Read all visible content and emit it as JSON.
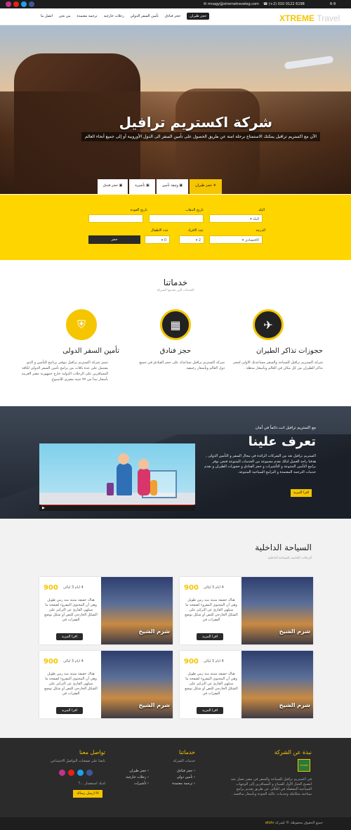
{
  "topbar": {
    "date": "6-9",
    "phone": "(+2) 010 0122 6198",
    "email": "mnagy@xtremetraveleg.com"
  },
  "nav": {
    "logo_a": "XTREME",
    "logo_b": "Travel",
    "items": [
      "حجز طيران",
      "حجز فنادق",
      "تأمين السفر الدولي",
      "رحلات خارجية",
      "ترجمة معتمدة",
      "من نحن",
      "اتصل بنا"
    ]
  },
  "hero": {
    "title": "شركة اكستريم ترافيل",
    "subtitle": "الآن مع اكستريم ترافيل يمكنك الاستمتاع برحلة امنة عن طريق الحصول على تأمين السفر الى الدول الأوروبية أو إلى جميع أنحاء العالم"
  },
  "tabs": [
    "حجز طيران",
    "وثيقة تأمين",
    "تأشيرة",
    "حجز فندق"
  ],
  "search": {
    "country_label": "البلد",
    "country_value": "البلد",
    "depart_label": "تاريخ الذهاب",
    "return_label": "تاريخ العودة",
    "class_label": "الدرجة",
    "class_value": "الاقتصادى",
    "adults_label": "عدد الافراد",
    "adults_value": "2",
    "kids_label": "عدد الاطفال",
    "kids_value": "0",
    "submit": "حجز"
  },
  "services": {
    "title": "خدماتنا",
    "sub": "الخدمات التي تقدمها الشركة",
    "items": [
      {
        "icon": "globe-icon",
        "title": "حجوزات تذاكر الطيران",
        "text": "شركة اكستريم ترافيل للسياحة والسفر مساعدتك الاولي لحجز تذاكر الطيران من كل مكان في العالم وبأسعار مذهلة ."
      },
      {
        "icon": "building-icon",
        "title": "حجز فنادق",
        "text": "شركة اكستريم ترافيل تساعدك على حجز الفنادق في جميع دول العالم وبأسعار رخيصة"
      },
      {
        "icon": "shield-icon",
        "title": "تأمين السفر الدولى",
        "text": "تتميز شركة اكستريم ترافيل بتوفير برنامج للتأمين و الذي يشتمل على عدة باقات من برامج تأمين السفر الدولي لكافة المسافرين على الرحلات الدولية خارج جمهورية مصر العربية بأسعار تبدأ من ٧٧ جنية مصرى للاسبوع."
      }
    ]
  },
  "about": {
    "kicker": "مع اكستريم ترافيل انت دائماً في أمان",
    "title": "تعرف علينا",
    "text": "اكستريم ترافيل تعد من الشركات الرائدة في مجال السفر و التأمين الدولى , هدفنا راحة العميل لذلك نقدم مجموعة من الخدمات المتنوعة فنحن نوفر برامج التأمين المتنوعة و التأشيرات و حجز الفنادق و حجوزات الطيران و نقدم خدمات الترجمة المعتمدة و البرامج السياحية المتنوعة.",
    "more": "اقرا المزيد"
  },
  "domestic": {
    "title": "السياحة الداخلية",
    "sub": "الرحلات الخاصة بالسياحة الداخلية",
    "cards": [
      {
        "price": "900",
        "duration": "4 ايام 3 ليالى",
        "dest": "شرم الشيخ",
        "desc": "هناك حقيقة مثبتة منذ زمن طويل وهي أن المحتوى المقروء لصفحة ما سيلهي القارئ عن التركيز على الشكل الخارجي للنص أو شكل توضع الفقرات في",
        "more": "اقرا المزيد"
      },
      {
        "price": "900",
        "duration": "4 ايام 3 ليالى",
        "dest": "شرم الشيخ",
        "desc": "هناك حقيقة مثبتة منذ زمن طويل وهي أن المحتوى المقروء لصفحة ما سيلهي القارئ عن التركيز على الشكل الخارجي للنص أو شكل توضع الفقرات في",
        "more": "اقرا المزيد"
      },
      {
        "price": "900",
        "duration": "4 ايام 3 ليالى",
        "dest": "شرم الشيخ",
        "desc": "هناك حقيقة مثبتة منذ زمن طويل وهي أن المحتوى المقروء لصفحة ما سيلهي القارئ عن التركيز على الشكل الخارجي للنص أو شكل توضع الفقرات في",
        "more": "اقرا المزيد"
      },
      {
        "price": "900",
        "duration": "4 ايام 3 ليالى",
        "dest": "شرم الشيخ",
        "desc": "هناك حقيقة مثبتة منذ زمن طويل وهي أن المحتوى المقروء لصفحة ما سيلهي القارئ عن التركيز على الشكل الخارجي للنص أو شكل توضع الفقرات في",
        "more": "اقرا المزيد"
      }
    ]
  },
  "footer": {
    "about_title": "نبذة عن الشركة",
    "about_text": "في اكستريم ترافيل للسياحة والسفر في مصر نعمل بجد لتصبح الخيار الأول للسياح و المسافرين إلى الوجهات السياحية المفضلة في العالم، عن طريق تقديم برامج سياحية متكاملة وخدمات عالية الجودة وبأسعار منافسة .",
    "badge": "XTREME",
    "services_title": "خدماتنا",
    "services_sub": "خدمات الشركة",
    "services_col1": [
      "حجز فنادق",
      "تأمين دولى",
      "ترجمة معتمدة"
    ],
    "services_col2": [
      "حجز طيران",
      "رحلات خارجية",
      "تأشيرات"
    ],
    "contact_title": "تواصل معنا",
    "contact_sub": "تابعنا على صفحات التواصل الاجتماعي",
    "question_placeholder": "لديك استفسار ...؟",
    "send": "ارسل رسالة"
  },
  "copyright": {
    "text": "جميع الحقوق محفوظة © لشركة",
    "credit": "etolv"
  },
  "colors": {
    "accent": "#f5c500",
    "dark": "#2a2a2a"
  }
}
